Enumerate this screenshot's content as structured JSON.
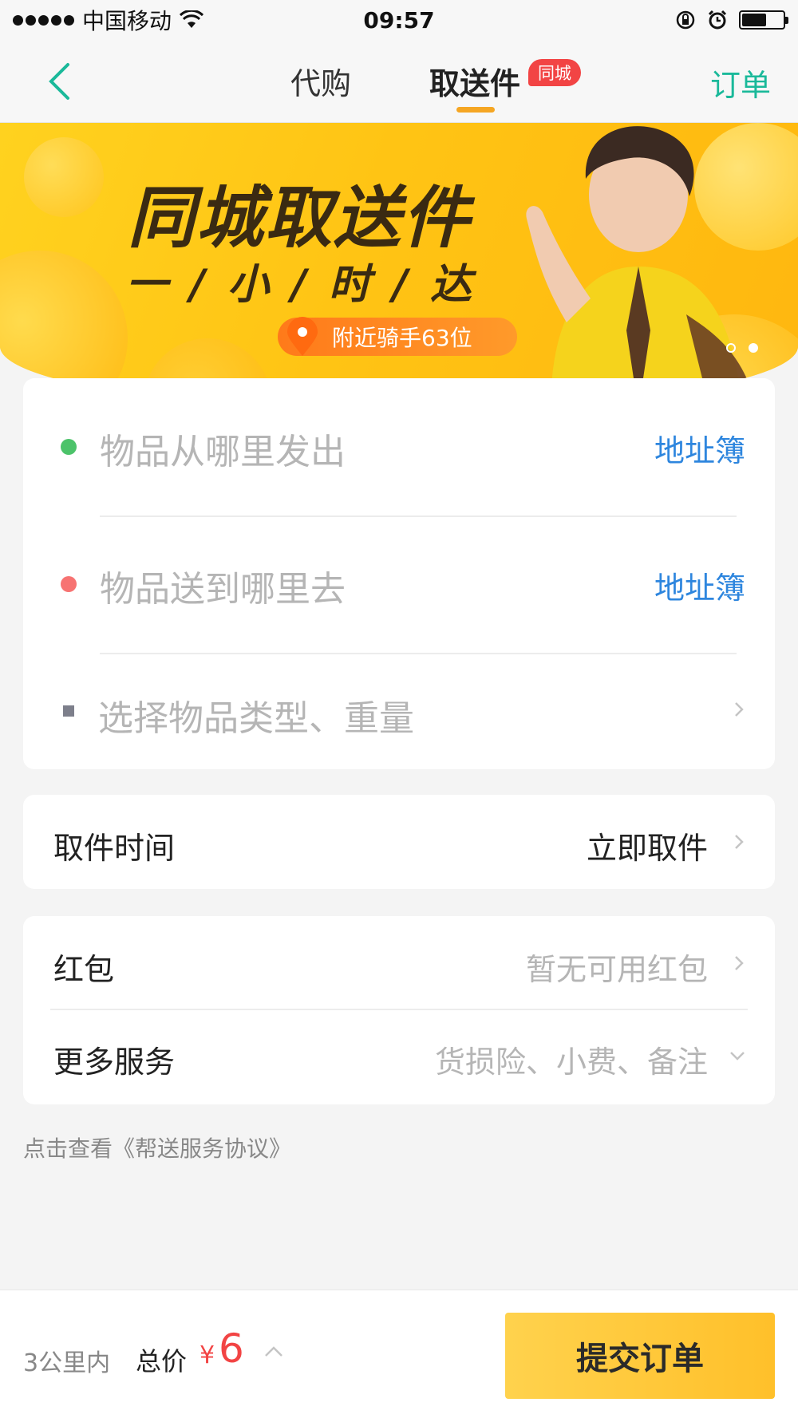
{
  "status_bar": {
    "carrier": "中国移动",
    "time": "09:57"
  },
  "nav": {
    "tabs": [
      {
        "label": "代购",
        "active": false
      },
      {
        "label": "取送件",
        "active": true
      }
    ],
    "badge": "同城",
    "orders_label": "订单",
    "accent_color": "#1ab99a",
    "underline_color": "#f5a623"
  },
  "banner": {
    "title": "同城取送件",
    "subtitle": "一/小/时/达",
    "rider_pill": "附近骑手63位",
    "pages": 2,
    "active_page": 2
  },
  "address_card": {
    "from_placeholder": "物品从哪里发出",
    "to_placeholder": "物品送到哪里去",
    "address_book_label": "地址簿",
    "item_placeholder": "选择物品类型、重量"
  },
  "pickup_time": {
    "label": "取件时间",
    "value": "立即取件"
  },
  "red_packet": {
    "label": "红包",
    "value": "暂无可用红包"
  },
  "more_services": {
    "label": "更多服务",
    "value": "货损险、小费、备注"
  },
  "protocol_link": "点击查看《帮送服务协议》",
  "bottom_bar": {
    "distance": "3公里内",
    "total_label": "总价",
    "currency": "¥",
    "price": "6",
    "submit_label": "提交订单"
  }
}
